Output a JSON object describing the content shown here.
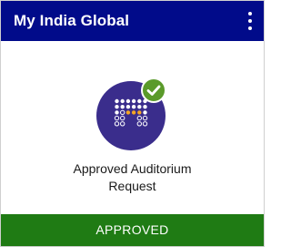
{
  "header": {
    "title": "My India Global",
    "menu_icon": "kebab-menu-icon",
    "background": "#010b8a"
  },
  "item": {
    "icon": "auditorium-seats-icon",
    "badge_icon": "check-icon",
    "icon_background": "#3a2d8c",
    "badge_color": "#5a9a2a",
    "selected_seat_color": "#f5a623",
    "title_line1": "Approved Auditorium",
    "title_line2": "Request"
  },
  "footer": {
    "status": "APPROVED",
    "background": "#1f7b14"
  }
}
